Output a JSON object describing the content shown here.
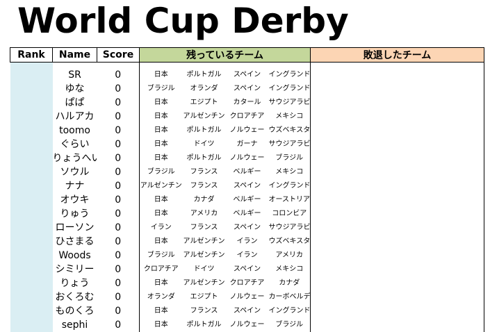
{
  "title": "World Cup Derby",
  "headers": {
    "rank": "Rank",
    "name": "Name",
    "score": "Score",
    "remaining": "残っているチーム",
    "lost": "敗退したチーム"
  },
  "colors": {
    "remaining_header": "#c4d79b",
    "lost_header": "#fcd5b4",
    "rank_column": "#daeef3"
  },
  "rows": [
    {
      "name": "SR",
      "score": "0",
      "teams": [
        "日本",
        "ポルトガル",
        "スペイン",
        "イングランド"
      ]
    },
    {
      "name": "ゆな",
      "score": "0",
      "teams": [
        "ブラジル",
        "オランダ",
        "スペイン",
        "イングランド"
      ]
    },
    {
      "name": "ぱぱ",
      "score": "0",
      "teams": [
        "日本",
        "エジプト",
        "カタール",
        "サウジアラビア"
      ]
    },
    {
      "name": "ハルアカ",
      "score": "0",
      "teams": [
        "日本",
        "アルゼンチン",
        "クロアチア",
        "メキシコ"
      ]
    },
    {
      "name": "toomo",
      "score": "0",
      "teams": [
        "日本",
        "ポルトガル",
        "ノルウェー",
        "ウズベキスタン"
      ]
    },
    {
      "name": "ぐらい",
      "score": "0",
      "teams": [
        "日本",
        "ドイツ",
        "ガーナ",
        "サウジアラビア"
      ]
    },
    {
      "name": "りょうへい",
      "score": "0",
      "teams": [
        "日本",
        "ポルトガル",
        "ノルウェー",
        "ブラジル"
      ]
    },
    {
      "name": "ソウル",
      "score": "0",
      "teams": [
        "ブラジル",
        "フランス",
        "ベルギー",
        "メキシコ"
      ]
    },
    {
      "name": "ナナ",
      "score": "0",
      "teams": [
        "アルゼンチン",
        "フランス",
        "スペイン",
        "イングランド"
      ]
    },
    {
      "name": "オウキ",
      "score": "0",
      "teams": [
        "日本",
        "カナダ",
        "ベルギー",
        "オーストリア"
      ]
    },
    {
      "name": "りゅう",
      "score": "0",
      "teams": [
        "日本",
        "アメリカ",
        "ベルギー",
        "コロンビア"
      ]
    },
    {
      "name": "ローソン",
      "score": "0",
      "teams": [
        "イラン",
        "フランス",
        "スペイン",
        "サウジアラビア"
      ]
    },
    {
      "name": "ひさまる",
      "score": "0",
      "teams": [
        "日本",
        "アルゼンチン",
        "イラン",
        "ウズベキスタン"
      ]
    },
    {
      "name": "Woods",
      "score": "0",
      "teams": [
        "ブラジル",
        "アルゼンチン",
        "イラン",
        "アメリカ"
      ]
    },
    {
      "name": "シミリー",
      "score": "0",
      "teams": [
        "クロアチア",
        "ドイツ",
        "スペイン",
        "メキシコ"
      ]
    },
    {
      "name": "りょう",
      "score": "0",
      "teams": [
        "日本",
        "アルゼンチン",
        "クロアチア",
        "カナダ"
      ]
    },
    {
      "name": "おくろむ",
      "score": "0",
      "teams": [
        "オランダ",
        "エジプト",
        "ノルウェー",
        "カーボベルデ"
      ]
    },
    {
      "name": "ものくろ",
      "score": "0",
      "teams": [
        "日本",
        "フランス",
        "スペイン",
        "イングランド"
      ]
    },
    {
      "name": "sephi",
      "score": "0",
      "teams": [
        "日本",
        "ポルトガル",
        "ノルウェー",
        "ブラジル"
      ]
    }
  ]
}
